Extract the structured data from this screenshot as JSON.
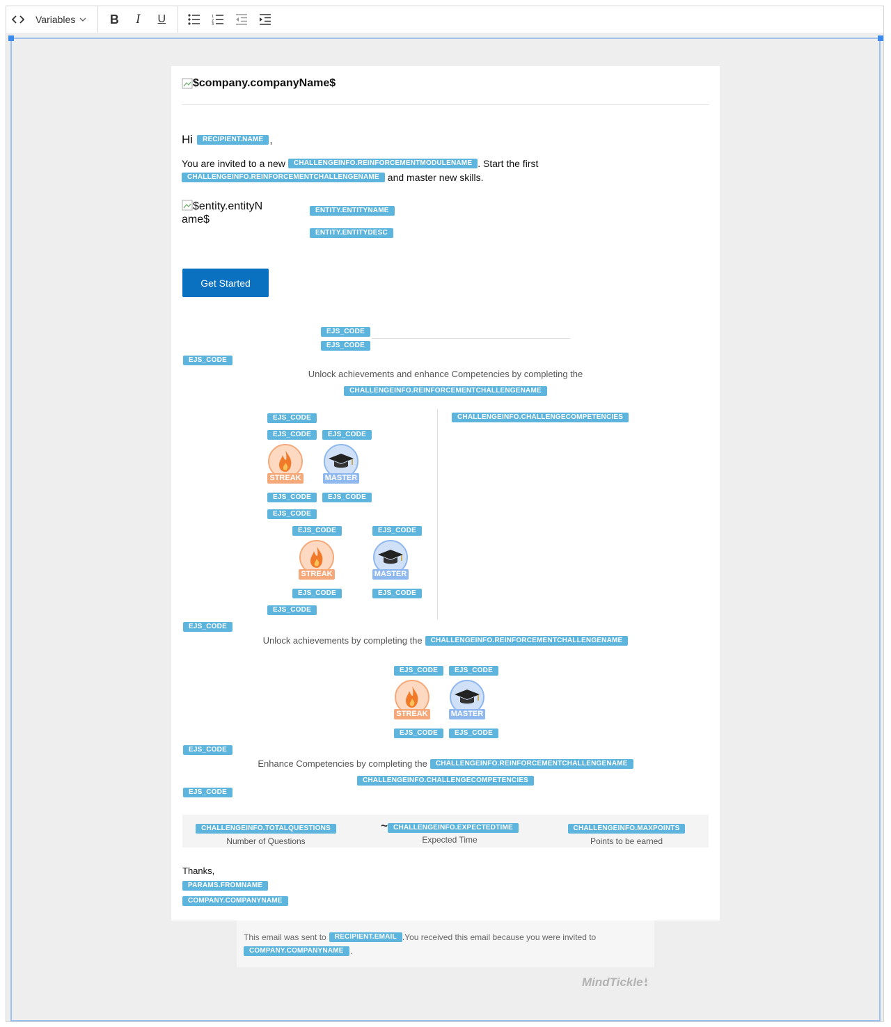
{
  "toolbar": {
    "variables_label": "Variables",
    "bold_label": "B",
    "italic_label": "I",
    "underline_label": "U"
  },
  "email": {
    "company_alt": "$company.companyName$",
    "greeting": "Hi",
    "greeting_comma": ",",
    "intro_1": "You are invited to a new",
    "intro_2": ". Start the first",
    "intro_3": "and master new skills.",
    "entity_alt": "$entity.entityName$",
    "cta_label": "Get Started",
    "unlock_both": "Unlock achievements and enhance Competencies by completing the",
    "unlock_achievements": "Unlock achievements by completing the",
    "enhance_competencies": "Enhance Competencies by completing the",
    "stats": {
      "tilde": "~",
      "questions_label": "Number of Questions",
      "time_label": "Expected Time",
      "points_label": "Points to be earned"
    },
    "thanks": "Thanks,",
    "footer_1": "This email was sent to",
    "footer_2": ".You received this email because you were invited to",
    "footer_3": ".",
    "brand": "MindTickle"
  },
  "tags": {
    "recipient_name": "RECIPIENT.NAME",
    "module_name": "CHALLENGEINFO.REINFORCEMENTMODULENAME",
    "challenge_name": "CHALLENGEINFO.REINFORCEMENTCHALLENGENAME",
    "entity_name": "ENTITY.ENTITYNAME",
    "entity_desc": "ENTITY.ENTITYDESC",
    "ejs": "EJS_CODE",
    "competencies": "CHALLENGEINFO.CHALLENGECOMPETENCIES",
    "total_questions": "CHALLENGEINFO.TOTALQUESTIONS",
    "expected_time": "CHALLENGEINFO.EXPECTEDTIME",
    "max_points": "CHALLENGEINFO.MAXPOINTS",
    "from_name": "PARAMS.FROMNAME",
    "company_name": "COMPANY.COMPANYNAME",
    "recipient_email": "RECIPIENT.EMAIL"
  },
  "badges": {
    "streak": "STREAK",
    "master": "MASTER"
  },
  "colors": {
    "tag": "#5db4dd",
    "cta": "#0a70c0",
    "streak": "#f5a97a",
    "master": "#8fb8ee"
  }
}
